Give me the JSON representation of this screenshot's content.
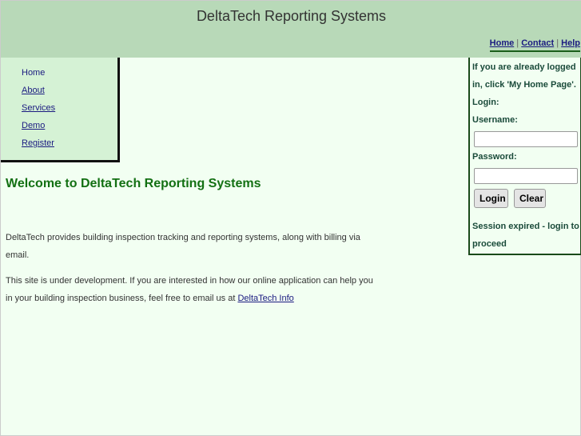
{
  "header": {
    "title": "DeltaTech Reporting Systems",
    "links": [
      "Home",
      "Contact",
      "Help"
    ],
    "separator": "|"
  },
  "nav": [
    "Home",
    "About",
    "Services",
    "Demo",
    "Register"
  ],
  "main": {
    "heading": "Welcome to DeltaTech Reporting Systems",
    "p1": "DeltaTech provides building inspection tracking and reporting systems, along with billing via email.",
    "p2": "This site is under development. If you are interested in how our online application can help you in your building inspection business, feel free to email us at ",
    "p2_link": "DeltaTech Info"
  },
  "login": {
    "intro": "If you are already logged in, click 'My Home Page'.",
    "login_label": "Login:",
    "username_label": "Username:",
    "username_value": "",
    "password_label": "Password:",
    "password_value": "",
    "login_button": "Login",
    "clear_button": "Clear",
    "status": "Session expired - login to proceed"
  }
}
